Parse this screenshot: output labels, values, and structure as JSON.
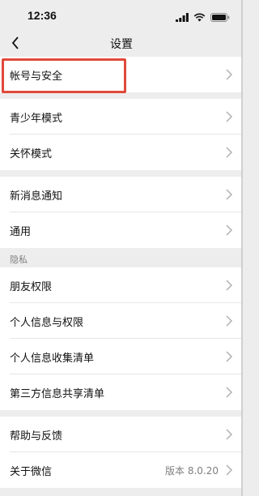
{
  "status_bar": {
    "time": "12:36"
  },
  "nav": {
    "title": "设置"
  },
  "groups": [
    {
      "items": [
        {
          "label": "帐号与安全"
        }
      ]
    },
    {
      "items": [
        {
          "label": "青少年模式"
        },
        {
          "label": "关怀模式"
        }
      ]
    },
    {
      "items": [
        {
          "label": "新消息通知"
        },
        {
          "label": "通用"
        }
      ]
    }
  ],
  "privacy_section": {
    "header": "隐私",
    "items": [
      {
        "label": "朋友权限"
      },
      {
        "label": "个人信息与权限"
      },
      {
        "label": "个人信息收集清单"
      },
      {
        "label": "第三方信息共享清单"
      }
    ]
  },
  "about_group": {
    "items": [
      {
        "label": "帮助与反馈"
      },
      {
        "label": "关于微信",
        "value": "版本 8.0.20"
      }
    ]
  },
  "colors": {
    "highlight": "#e0493a",
    "background": "#ededed",
    "secondary_text": "#7f7f7f"
  }
}
